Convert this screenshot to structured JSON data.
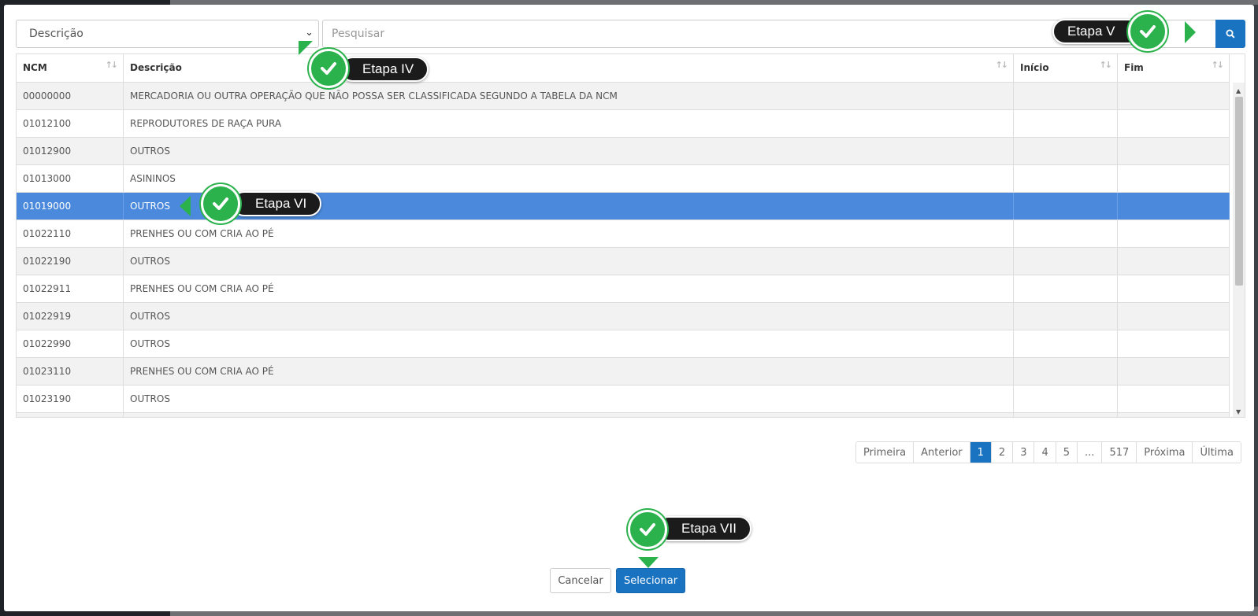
{
  "filter": {
    "field_selected": "Descrição",
    "search_placeholder": "Pesquisar"
  },
  "table": {
    "headers": [
      "NCM",
      "Descrição",
      "Início",
      "Fim"
    ],
    "rows": [
      {
        "ncm": "00000000",
        "descricao": "MERCADORIA OU OUTRA OPERAÇÃO QUE NÃO POSSA SER CLASSIFICADA SEGUNDO A TABELA DA NCM",
        "inicio": "",
        "fim": ""
      },
      {
        "ncm": "01012100",
        "descricao": "REPRODUTORES DE RAÇA PURA",
        "inicio": "",
        "fim": ""
      },
      {
        "ncm": "01012900",
        "descricao": "OUTROS",
        "inicio": "",
        "fim": ""
      },
      {
        "ncm": "01013000",
        "descricao": "ASININOS",
        "inicio": "",
        "fim": ""
      },
      {
        "ncm": "01019000",
        "descricao": "OUTROS",
        "inicio": "",
        "fim": ""
      },
      {
        "ncm": "01022110",
        "descricao": "PRENHES OU COM CRIA AO PÉ",
        "inicio": "",
        "fim": ""
      },
      {
        "ncm": "01022190",
        "descricao": "OUTROS",
        "inicio": "",
        "fim": ""
      },
      {
        "ncm": "01022911",
        "descricao": "PRENHES OU COM CRIA AO PÉ",
        "inicio": "",
        "fim": ""
      },
      {
        "ncm": "01022919",
        "descricao": "OUTROS",
        "inicio": "",
        "fim": ""
      },
      {
        "ncm": "01022990",
        "descricao": "OUTROS",
        "inicio": "",
        "fim": ""
      },
      {
        "ncm": "01023110",
        "descricao": "PRENHES OU COM CRIA AO PÉ",
        "inicio": "",
        "fim": ""
      },
      {
        "ncm": "01023190",
        "descricao": "OUTROS",
        "inicio": "",
        "fim": ""
      }
    ],
    "selected_index": 4
  },
  "pagination": [
    "Primeira",
    "Anterior",
    "1",
    "2",
    "3",
    "4",
    "5",
    "...",
    "517",
    "Próxima",
    "Última"
  ],
  "pagination_active": "1",
  "buttons": {
    "cancel": "Cancelar",
    "select": "Selecionar"
  },
  "callouts": {
    "etapa_iv": "Etapa IV",
    "etapa_v": "Etapa V",
    "etapa_vi": "Etapa VI",
    "etapa_vii": "Etapa VII"
  },
  "icons": {
    "search_button": "search-icon",
    "callout_badge": "check-icon"
  },
  "colors": {
    "primary": "#1a73c1",
    "selected_row": "#4a89dc",
    "badge_green": "#2bb24c"
  }
}
